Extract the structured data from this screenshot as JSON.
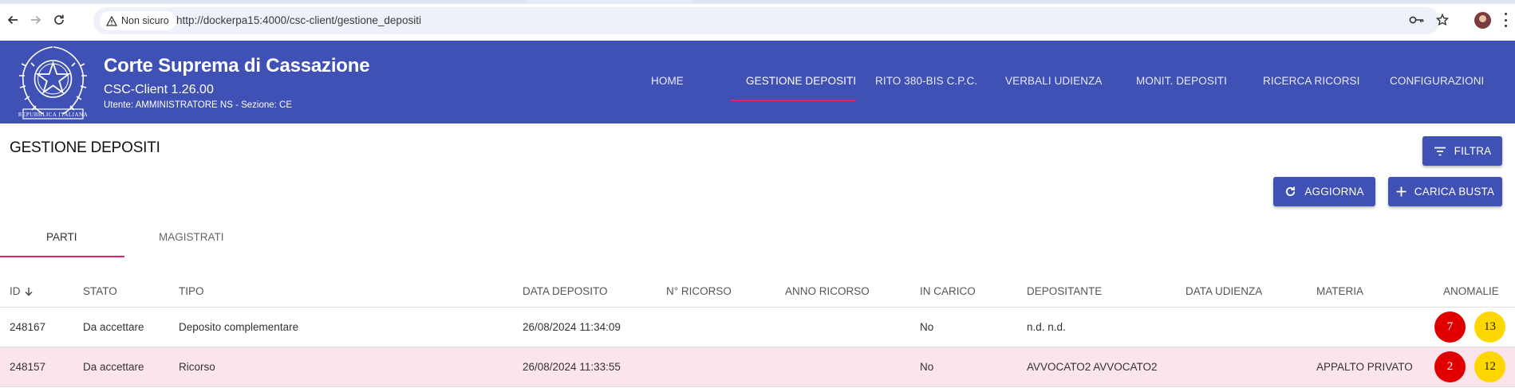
{
  "browser": {
    "security_label": "Non sicuro",
    "url": "http://dockerpa15:4000/csc-client/gestione_depositi"
  },
  "header": {
    "title": "Corte Suprema di Cassazione",
    "version": "CSC-Client 1.26.00",
    "user": "Utente: AMMINISTRATORE NS - Sezione: CE",
    "emblem_text": "REPUBBLICA ITALIANA"
  },
  "nav": {
    "items": [
      {
        "label": "HOME"
      },
      {
        "label": "GESTIONE DEPOSITI"
      },
      {
        "label": "RITO 380-BIS C.P.C."
      },
      {
        "label": "VERBALI UDIENZA"
      },
      {
        "label": "MONIT. DEPOSITI"
      },
      {
        "label": "RICERCA RICORSI"
      },
      {
        "label": "CONFIGURAZIONI"
      }
    ],
    "active": "GESTIONE DEPOSITI"
  },
  "page": {
    "title": "GESTIONE DEPOSITI",
    "buttons": {
      "filtra": "FILTRA",
      "aggiorna": "AGGIORNA",
      "carica_busta": "CARICA BUSTA"
    },
    "tabs": [
      {
        "label": "PARTI"
      },
      {
        "label": "MAGISTRATI"
      }
    ],
    "active_tab": "PARTI"
  },
  "table": {
    "columns": {
      "id": "ID",
      "stato": "STATO",
      "tipo": "TIPO",
      "data_deposito": "DATA DEPOSITO",
      "n_ricorso": "N° RICORSO",
      "anno_ricorso": "ANNO RICORSO",
      "in_carico": "IN CARICO",
      "depositante": "DEPOSITANTE",
      "data_udienza": "DATA UDIENZA",
      "materia": "MATERIA",
      "anomalie": "ANOMALIE"
    },
    "sort": {
      "column": "ID",
      "direction": "desc"
    },
    "rows": [
      {
        "id": "248167",
        "stato": "Da accettare",
        "tipo": "Deposito complementare",
        "data_deposito": "26/08/2024 11:34:09",
        "n_ricorso": "",
        "anno_ricorso": "",
        "in_carico": "No",
        "depositante": "n.d. n.d.",
        "data_udienza": "",
        "materia": "",
        "anomalie_errori": "7",
        "anomalie_avvisi": "13"
      },
      {
        "id": "248157",
        "stato": "Da accettare",
        "tipo": "Ricorso",
        "data_deposito": "26/08/2024 11:33:55",
        "n_ricorso": "",
        "anno_ricorso": "",
        "in_carico": "No",
        "depositante": "AVVOCATO2 AVVOCATO2",
        "data_udienza": "",
        "materia": "APPALTO PRIVATO",
        "anomalie_errori": "2",
        "anomalie_avvisi": "12"
      }
    ]
  },
  "colors": {
    "primary": "#3f51b5",
    "accent": "#e91e63",
    "selected_row": "#fce4ec",
    "anomaly_error": "#e10000",
    "anomaly_warning": "#ffd700"
  }
}
